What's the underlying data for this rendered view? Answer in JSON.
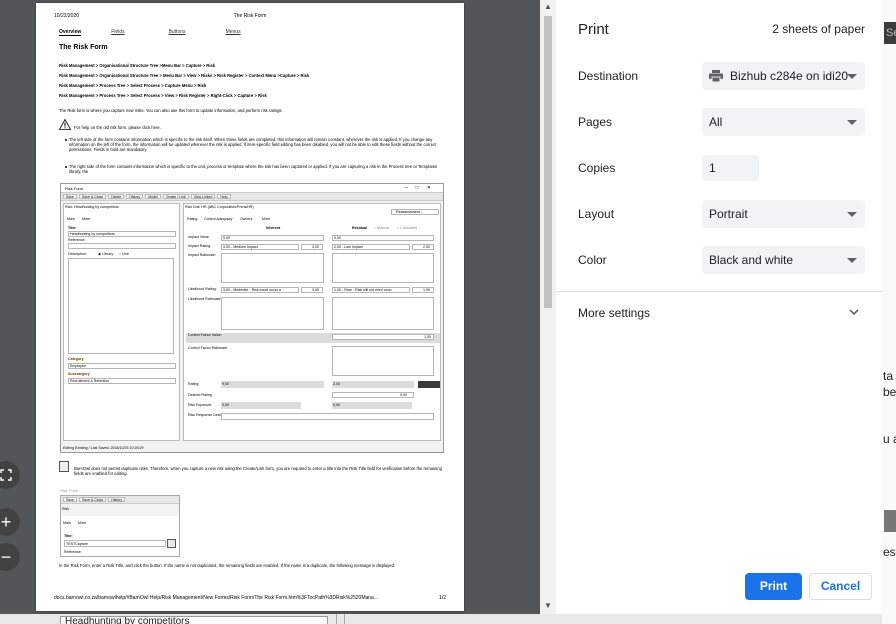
{
  "preview": {
    "date": "10/22/2020",
    "header_title": "The Risk Form",
    "nav": [
      "Overview",
      "Fields",
      "Buttons",
      "Menus"
    ],
    "page_title": "The Risk Form",
    "crumbs": [
      "Risk Management > Organisational Structure Tree >Menu Bar > Capture > Risk",
      "Risk Management > Organisational Structure Tree > Menu Bar > View > Risks > Risk Register > Context Menu >Capture > Risk",
      "Risk Management > Process Tree > Select Process > Capture Menu > Risk",
      "Risk Management > Process Tree > Select Process > View > Risk Register > Right-Click > Capture > Risk"
    ],
    "intro": "The Risk form is where you capture new risks. You can also use this form to update information, and perform risk ratings.",
    "help_note": "For help on the old risk form, please click here.",
    "bullets": [
      "The left side of the form contains information which is specific to the risk itself. When these fields are completed, this information will remain constant, wherever the risk is applied. If you change any information on the left of the form, the information will be updated wherever the risk is applied. If item-specific field editing has been disabled, you will not be able to edit these fields without the correct permissions. Fields in bold are mandatory.",
      "The right side of the form contains information which is specific to the unit, process or template where the risk has been captured or applied. If you are capturing a risk in the Process tree or Templates library, the"
    ],
    "risk_form": {
      "window_title": "Risk Form",
      "toolbar": [
        "Save",
        "Save & Close",
        "Delete",
        "History",
        "Model",
        "Create / Link",
        "View Linked",
        "Help"
      ],
      "left_header": "Risk: Headhunting by competitors",
      "right_header": "Risk Unit: HR (ABC Corporation/Prens/HR)",
      "title_label": "Title:",
      "title_value": "Headhunting by competitors",
      "reference_label": "Reference:",
      "description_label": "Description:",
      "radio_library": "Library",
      "radio_unit": "Unit",
      "category_label": "Category",
      "category_value": "Employee",
      "subcategory_label": "Subcategory",
      "subcategory_value": "Recruitment & Retention",
      "tabs": [
        "Rating",
        "Control Adequacy",
        "Owners",
        "More"
      ],
      "left_tabs": [
        "Main",
        "More"
      ],
      "reassessment": "Reassessment...",
      "inherent": "Inherent",
      "residual": "Residual",
      "manual": "Manual",
      "calculated": "Calculated",
      "impact_value_label": "Impact Value:",
      "impact_value": "0,00",
      "impact_rating_label": "Impact Rating:",
      "impact_rating_inh": "3,00 - Medium Impact",
      "impact_rating_res": "2,00 - Low Impact",
      "impact_rating_inh_num": "3,00",
      "impact_rating_res_num": "2,00",
      "impact_rationale_label": "Impact Rationale:",
      "likelihood_rating_label": "Likelihood Rating:",
      "likelihood_inh": "3,00 - Moderate - Risk could occur a",
      "likelihood_res": "1,00 - Rare - Risk will not even occu",
      "likelihood_inh_num": "3,00",
      "likelihood_res_num": "1,00",
      "likelihood_rationale_label": "Likelihood Rationale:",
      "control_factor_label": "Control Factor Value:",
      "control_factor_value": "1,00",
      "control_factor_rationale_label": "Control Factor Rationale:",
      "rating_label": "Rating:",
      "rating_inh": "9,00",
      "rating_res": "2,00",
      "desired_rating_label": "Desired Rating",
      "desired_rating": "0,00",
      "risk_exposure_label": "Risk Exposure:",
      "risk_exposure_inh": "0,00",
      "risk_exposure_res": "0,00",
      "risk_response_label": "Risk Response Decision:",
      "status": "Editing Existing / Last Saved: 2018/10/25 10:25:29"
    },
    "dup_note": "BarnOwl does not permit duplicate risks. Therefore, when you capture a new risk using the Create/Link form, you are required to enter a title into the Risk Title field for verification before the remaining fields are enabled for editing.",
    "risk_form_small": {
      "window_title": "Risk Form",
      "toolbar": [
        "Save",
        "Save & Close",
        "History"
      ],
      "header": "Risk",
      "tabs": [
        "Main",
        "More"
      ],
      "title_label": "Title:",
      "title_value": "TESTCapture",
      "reference_label": "Reference:"
    },
    "outro": "In the Risk Form, enter a Risk Title, and click the button. If the name is not duplicated, the remaining fields are enabled. If the name is a duplicate, the following message is displayed:",
    "footer_url": "docs.barnowl.co.za/barnowlhelp/#BarnOwl Help/Risk Management/New Forms/Risk Form/The Risk Form.htm%3FTocPath%3DRisk%2520Mana...",
    "footer_page": "1/2"
  },
  "dialog": {
    "title": "Print",
    "sheets": "2 sheets of paper",
    "destination_label": "Destination",
    "destination_value": "Bizhub c284e on idi20",
    "pages_label": "Pages",
    "pages_value": "All",
    "copies_label": "Copies",
    "copies_value": "1",
    "layout_label": "Layout",
    "layout_value": "Portrait",
    "color_label": "Color",
    "color_value": "Black and white",
    "more_settings": "More settings",
    "print_button": "Print",
    "cancel_button": "Cancel"
  },
  "background": {
    "tab_text": "Se",
    "side_text": [
      "ta",
      "be",
      "u a",
      "es"
    ],
    "bottom_box": "Headhunting by competitors"
  },
  "colors": {
    "accent": "#1a73e8",
    "preview_bg": "#525659"
  }
}
